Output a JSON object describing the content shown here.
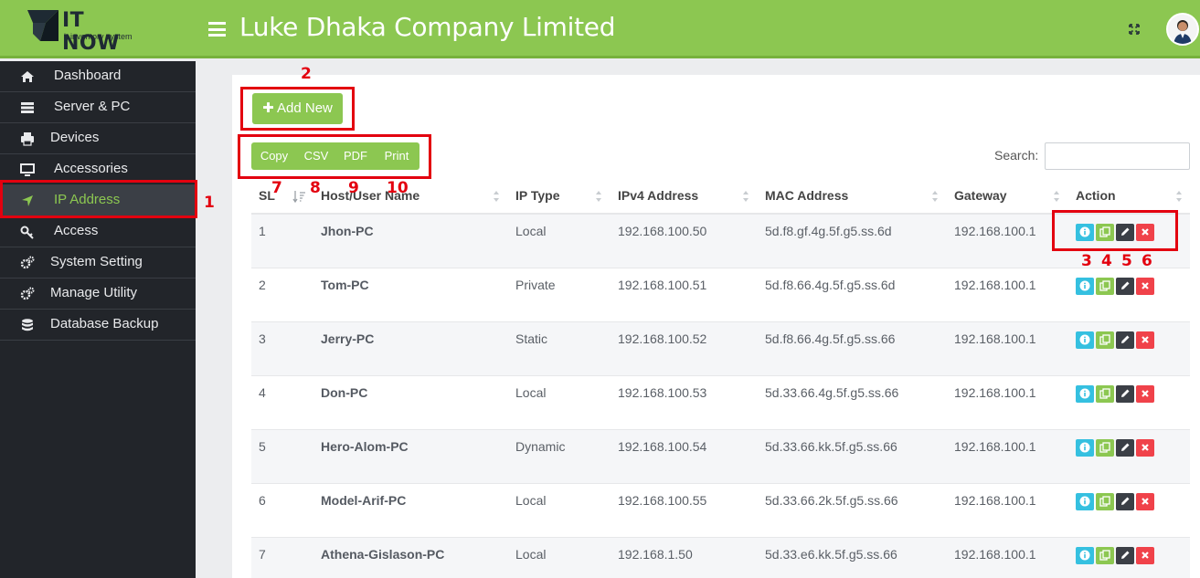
{
  "brand": {
    "name": "IT NOW",
    "tagline": "it inventory system"
  },
  "header": {
    "company_name": "Luke Dhaka Company Limited",
    "menu_icon": "hamburger-icon",
    "fullscreen_icon": "expand-icon",
    "avatar_icon": "user-avatar"
  },
  "sidebar": {
    "items": [
      {
        "label": "Dashboard",
        "icon": "home-icon"
      },
      {
        "label": "Server & PC",
        "icon": "server-icon"
      },
      {
        "label": "Devices",
        "icon": "printer-icon"
      },
      {
        "label": "Accessories",
        "icon": "monitor-icon"
      },
      {
        "label": "IP Address",
        "icon": "location-arrow-icon",
        "active": true
      },
      {
        "label": "Access",
        "icon": "key-icon"
      },
      {
        "label": "System Setting",
        "icon": "gears-icon"
      },
      {
        "label": "Manage Utility",
        "icon": "gears-icon"
      },
      {
        "label": "Database Backup",
        "icon": "database-icon"
      }
    ]
  },
  "toolbar": {
    "add_label": "✚ Add New",
    "export_buttons": [
      "Copy",
      "CSV",
      "PDF",
      "Print"
    ],
    "search_label": "Search:",
    "search_value": ""
  },
  "table": {
    "columns": [
      "SL",
      "Host/User Name",
      "IP Type",
      "IPv4 Address",
      "MAC Address",
      "Gateway",
      "Action"
    ],
    "rows": [
      {
        "sl": "1",
        "host": "Jhon-PC",
        "type": "Local",
        "ipv4": "192.168.100.50",
        "mac": "5d.f8.gf.4g.5f.g5.ss.6d",
        "gateway": "192.168.100.1"
      },
      {
        "sl": "2",
        "host": "Tom-PC",
        "type": "Private",
        "ipv4": "192.168.100.51",
        "mac": "5d.f8.66.4g.5f.g5.ss.6d",
        "gateway": "192.168.100.1"
      },
      {
        "sl": "3",
        "host": "Jerry-PC",
        "type": "Static",
        "ipv4": "192.168.100.52",
        "mac": "5d.f8.66.4g.5f.g5.ss.66",
        "gateway": "192.168.100.1"
      },
      {
        "sl": "4",
        "host": "Don-PC",
        "type": "Local",
        "ipv4": "192.168.100.53",
        "mac": "5d.33.66.4g.5f.g5.ss.66",
        "gateway": "192.168.100.1"
      },
      {
        "sl": "5",
        "host": "Hero-Alom-PC",
        "type": "Dynamic",
        "ipv4": "192.168.100.54",
        "mac": "5d.33.66.kk.5f.g5.ss.66",
        "gateway": "192.168.100.1"
      },
      {
        "sl": "6",
        "host": "Model-Arif-PC",
        "type": "Local",
        "ipv4": "192.168.100.55",
        "mac": "5d.33.66.2k.5f.g5.ss.66",
        "gateway": "192.168.100.1"
      },
      {
        "sl": "7",
        "host": "Athena-Gislason-PC",
        "type": "Local",
        "ipv4": "192.168.1.50",
        "mac": "5d.33.e6.kk.5f.g5.ss.66",
        "gateway": "192.168.100.1"
      }
    ],
    "action_icons": [
      "info-icon",
      "copy-icon",
      "edit-pencil-icon",
      "delete-x-icon"
    ]
  },
  "annotations": [
    "1",
    "2",
    "3",
    "4",
    "5",
    "6",
    "7",
    "8",
    "9",
    "10"
  ],
  "colors": {
    "brand_green": "#8cc751",
    "sidebar_bg": "#22252a",
    "annotation_red": "#e3000f",
    "info": "#35c0e0",
    "danger": "#f0424a",
    "dark": "#3b3f46"
  }
}
